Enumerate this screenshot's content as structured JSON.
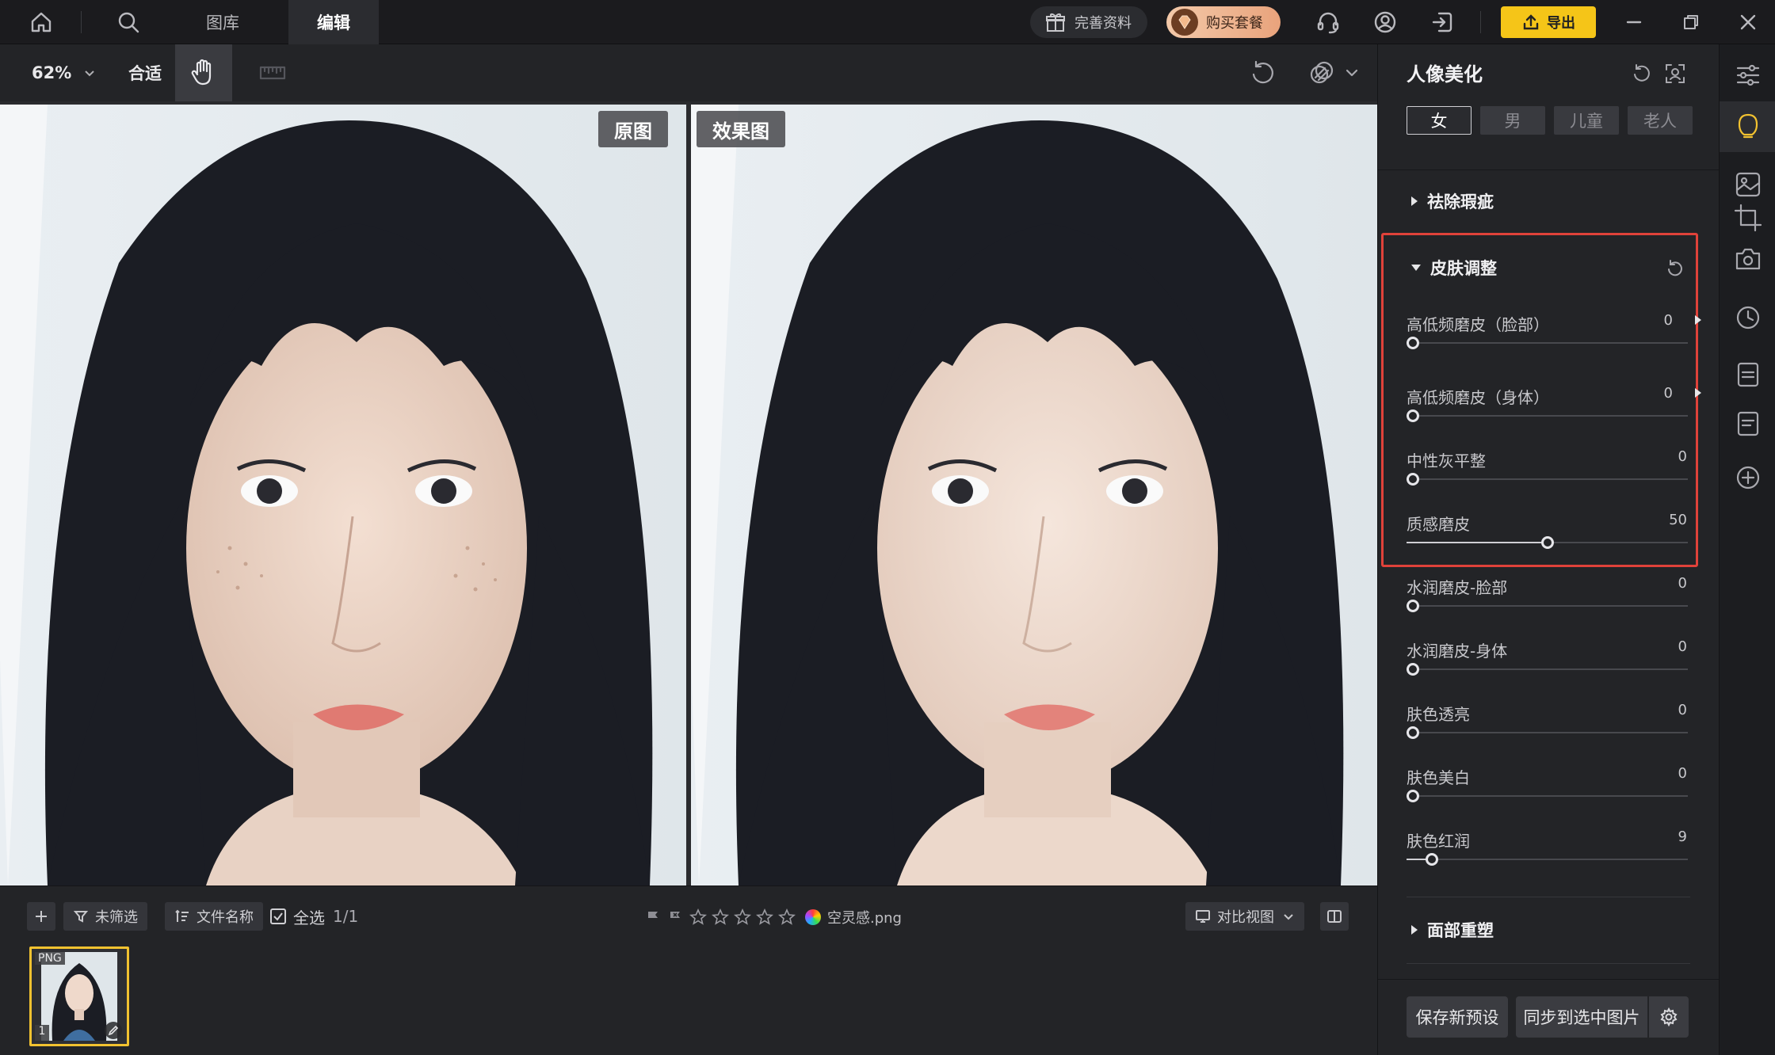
{
  "nav": {
    "tabs": [
      "图库",
      "编辑"
    ],
    "active_tab": "编辑"
  },
  "topbar": {
    "gift_label": "完善资料",
    "buy_label": "购买套餐",
    "export_label": "导出"
  },
  "toolbar": {
    "zoom": "62%",
    "fit_label": "合适"
  },
  "canvas": {
    "original_label": "原图",
    "result_label": "效果图"
  },
  "filmstrip": {
    "filter_label": "未筛选",
    "sort_label": "文件名称",
    "select_all_label": "全选",
    "count": "1/1",
    "file_name": "空灵感.png",
    "view_mode_label": "对比视图",
    "thumb_badge": "PNG",
    "thumb_index": "1"
  },
  "panel": {
    "title": "人像美化",
    "genders": [
      "女",
      "男",
      "儿童",
      "老人"
    ],
    "selected_gender": "女",
    "sections": {
      "blemish": "祛除瑕疵",
      "skin": "皮肤调整",
      "face": "面部重塑"
    },
    "sliders": [
      {
        "label": "高低频磨皮（脸部）",
        "value": 0,
        "expandable": true
      },
      {
        "label": "高低频磨皮（身体）",
        "value": 0,
        "expandable": true
      },
      {
        "label": "中性灰平整",
        "value": 0
      },
      {
        "label": "质感磨皮",
        "value": 50
      },
      {
        "label": "水润磨皮-脸部",
        "value": 0
      },
      {
        "label": "水润磨皮-身体",
        "value": 0
      },
      {
        "label": "肤色透亮",
        "value": 0
      },
      {
        "label": "肤色美白",
        "value": 0
      },
      {
        "label": "肤色红润",
        "value": 9
      }
    ],
    "slider_max": 100,
    "save_preset_label": "保存新预设",
    "sync_label": "同步到选中图片"
  },
  "colors": {
    "accent_export": "#f5c518",
    "highlight_border": "#e0423a",
    "selected_thumb_border": "#f2c230"
  }
}
